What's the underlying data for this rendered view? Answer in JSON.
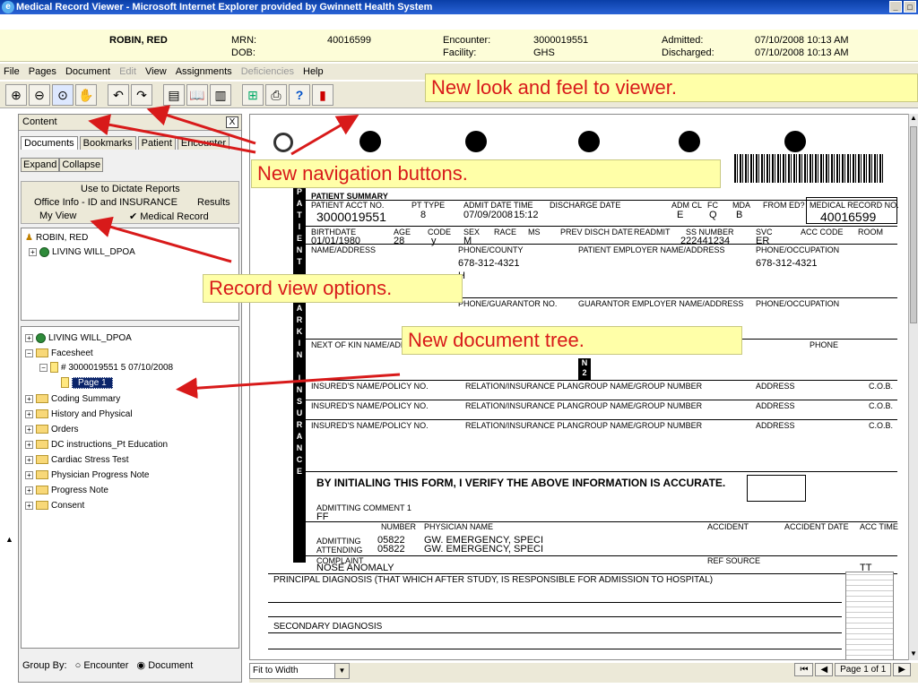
{
  "window": {
    "title": "Medical Record Viewer - Microsoft Internet Explorer provided by Gwinnett Health System"
  },
  "patient": {
    "name": "ROBIN, RED",
    "mrn_label": "MRN:",
    "mrn": "40016599",
    "dob_label": "DOB:",
    "encounter_label": "Encounter:",
    "encounter": "3000019551",
    "facility_label": "Facility:",
    "facility": "GHS",
    "admitted_label": "Admitted:",
    "admitted": "07/10/2008 10:13 AM",
    "discharged_label": "Discharged:",
    "discharged": "07/10/2008 10:13 AM"
  },
  "menu": {
    "file": "File",
    "pages": "Pages",
    "document": "Document",
    "edit": "Edit",
    "view": "View",
    "assignments": "Assignments",
    "deficiencies": "Deficiencies",
    "help": "Help"
  },
  "callouts": {
    "look": "New look and feel to viewer.",
    "nav": "New navigation buttons.",
    "record": "Record view options.",
    "tree": "New document tree."
  },
  "content_pane": {
    "title": "Content",
    "close": "X",
    "tabs": [
      "Documents",
      "Bookmarks",
      "Patient",
      "Encounter"
    ],
    "expand": "Expand",
    "collapse": "Collapse",
    "dictate": "Use to Dictate Reports",
    "office_info": "Office Info - ID and INSURANCE",
    "results": "Results",
    "my_view": "My View",
    "medical_record": "✔ Medical Record",
    "tree1_patient": "ROBIN, RED",
    "tree1_living": "LIVING WILL_DPOA",
    "tree2": {
      "living": "LIVING WILL_DPOA",
      "facesheet": "Facesheet",
      "encounter_doc": "# 3000019551  5  07/10/2008",
      "page1": "Page 1",
      "folders": [
        "Coding Summary",
        "History and Physical",
        "Orders",
        "DC instructions_Pt Education",
        "Cardiac Stress Test",
        "Physician Progress Note",
        "Progress Note",
        "Consent"
      ]
    },
    "group_by": "Group By:",
    "group_encounter": "Encounter",
    "group_document": "Document"
  },
  "document": {
    "acct_suffix": "9551",
    "patient_summary": "PATIENT SUMMARY",
    "acct_label": "PATIENT ACCT NO.",
    "acct": "3000019551",
    "pt_type_label": "PT TYPE",
    "pt_type": "8",
    "admit_date_label": "ADMIT DATE",
    "admit_date": "07/09/2008",
    "time_label": "TIME",
    "time": "15:12",
    "discharge_label": "DISCHARGE DATE",
    "adm_cl_label": "ADM CL",
    "adm_cl": "E",
    "fc_label": "FC",
    "fc": "Q",
    "mda_label": "MDA",
    "mda": "B",
    "from_ed_label": "FROM ED?",
    "mrn_label": "MEDICAL RECORD NO.",
    "mrn": "40016599",
    "birthdate_label": "BIRTHDATE",
    "birthdate": "01/01/1980",
    "age_label": "AGE",
    "age": "28",
    "code_label": "CODE",
    "code": "y",
    "sex_label": "SEX",
    "sex": "M",
    "race_label": "RACE",
    "ms_label": "MS",
    "prev_disch_label": "PREV DISCH DATE",
    "readmit_label": "READMIT",
    "ss_label": "SS NUMBER",
    "ss": "222441234",
    "svc_label": "SVC",
    "svc": "ER",
    "acc_code_label": "ACC CODE",
    "room_label": "ROOM",
    "name_address_label": "NAME/ADDRESS",
    "phone_county_label": "PHONE/COUNTY",
    "phone": "678-312-4321",
    "phone_h": "H",
    "employer_label": "PATIENT EMPLOYER NAME/ADDRESS",
    "phone_occ_label": "PHONE/OCCUPATION",
    "phone2": "678-312-4321",
    "guarantor_phone_label": "PHONE/GUARANTOR NO.",
    "guarantor_emp_label": "GUARANTOR EMPLOYER NAME/ADDRESS",
    "phone_occ2_label": "PHONE/OCCUPATION",
    "kin_label": "NEXT OF KIN NAME/ADDR",
    "phone3_label": "PHONE",
    "n_letter": "N",
    "n_digit": "2",
    "insured_label": "INSURED'S NAME/POLICY NO.",
    "relation_label": "RELATION/INSURANCE PLAN",
    "group_label": "GROUP NAME/GROUP NUMBER",
    "address_label": "ADDRESS",
    "cob_label": "C.O.B.",
    "initial_statement": "BY INITIALING THIS FORM, I VERIFY THE ABOVE INFORMATION IS ACCURATE.",
    "admit_comment_label": "ADMITTING COMMENT 1",
    "admit_comment": "FF",
    "number_label": "NUMBER",
    "physician_label": "PHYSICIAN NAME",
    "accident_label": "ACCIDENT",
    "accident_date_label": "ACCIDENT DATE",
    "acc_time_label": "ACC TIME",
    "admitting_label": "ADMITTING",
    "admitting_no": "05822",
    "admitting_name": "GW. EMERGENCY, SPECI",
    "attending_label": "ATTENDING",
    "attending_no": "05822",
    "attending_name": "GW. EMERGENCY, SPECI",
    "complaint_label": "COMPLAINT",
    "complaint": "NOSE ANOMALY",
    "ref_source_label": "REF SOURCE",
    "tt": "TT",
    "principal": "PRINCIPAL DIAGNOSIS (THAT WHICH AFTER STUDY, IS RESPONSIBLE FOR ADMISSION TO HOSPITAL)",
    "secondary": "SECONDARY DIAGNOSIS",
    "sidebar_letters": "PATIENTGUARANTORKININSURANCE"
  },
  "footer": {
    "fit": "Fit to Width",
    "page": "Page 1 of 1"
  },
  "colors": {
    "accent_red": "#d81a1a",
    "callout_bg": "#ffffa8",
    "patient_bar": "#fdfdd8"
  }
}
